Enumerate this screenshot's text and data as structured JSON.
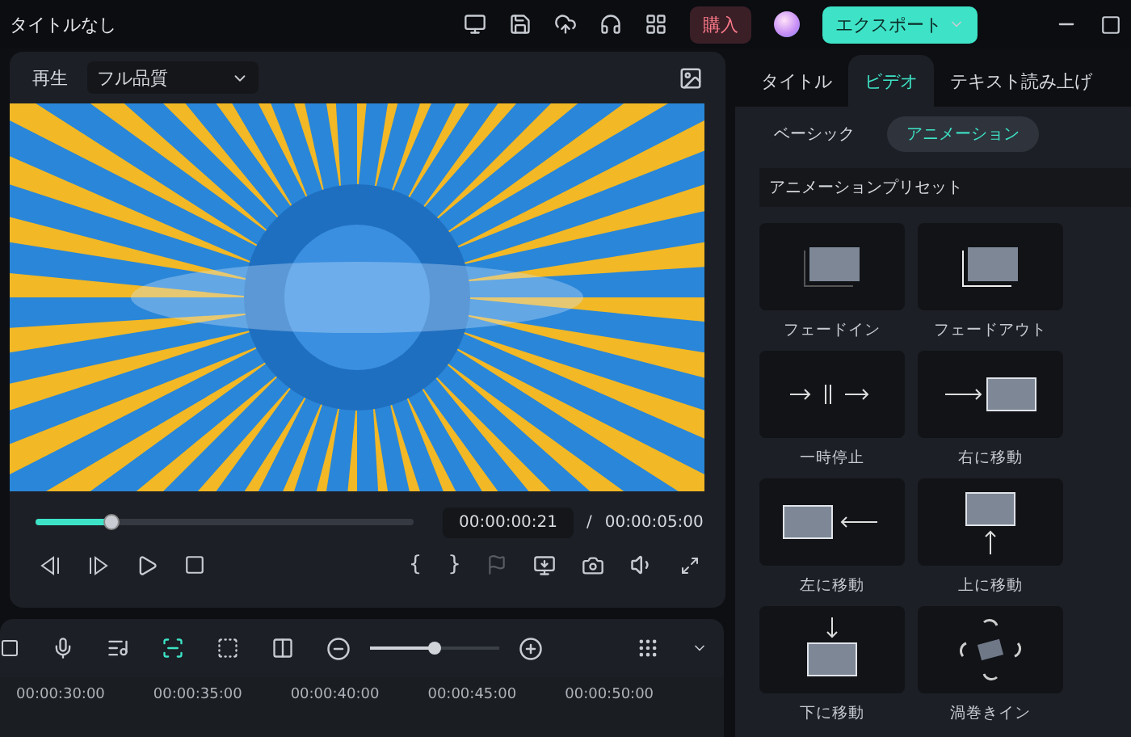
{
  "window": {
    "title": "タイトルなし",
    "buy_button": "購入",
    "export_button": "エクスポート"
  },
  "player": {
    "label": "再生",
    "quality": "フル品質",
    "progress": {
      "level": 0.2
    },
    "current_time": "00:00:00:21",
    "separator": "/",
    "total_time": "00:00:05:00",
    "marker_buttons": [
      "{",
      "}"
    ]
  },
  "timeline": {
    "zoom": {
      "level": 0.5
    },
    "ruler": [
      "00:00:30:00",
      "00:00:35:00",
      "00:00:40:00",
      "00:00:45:00",
      "00:00:50:00"
    ]
  },
  "panel": {
    "tabs": [
      {
        "label": "タイトル",
        "selected": false
      },
      {
        "label": "ビデオ",
        "selected": true
      },
      {
        "label": "テキスト読み上げ",
        "selected": false
      }
    ],
    "subtabs": [
      {
        "label": "ベーシック",
        "selected": false
      },
      {
        "label": "アニメーション",
        "selected": true
      }
    ],
    "section": "アニメーションプリセット",
    "presets": [
      {
        "label": "フェードイン",
        "kind": "fade-in"
      },
      {
        "label": "フェードアウト",
        "kind": "fade-out"
      },
      {
        "label": "一時停止",
        "kind": "pause"
      },
      {
        "label": "右に移動",
        "kind": "move-right"
      },
      {
        "label": "左に移動",
        "kind": "move-left"
      },
      {
        "label": "上に移動",
        "kind": "move-up"
      },
      {
        "label": "下に移動",
        "kind": "move-down"
      },
      {
        "label": "渦巻きイン",
        "kind": "swirl"
      }
    ]
  }
}
